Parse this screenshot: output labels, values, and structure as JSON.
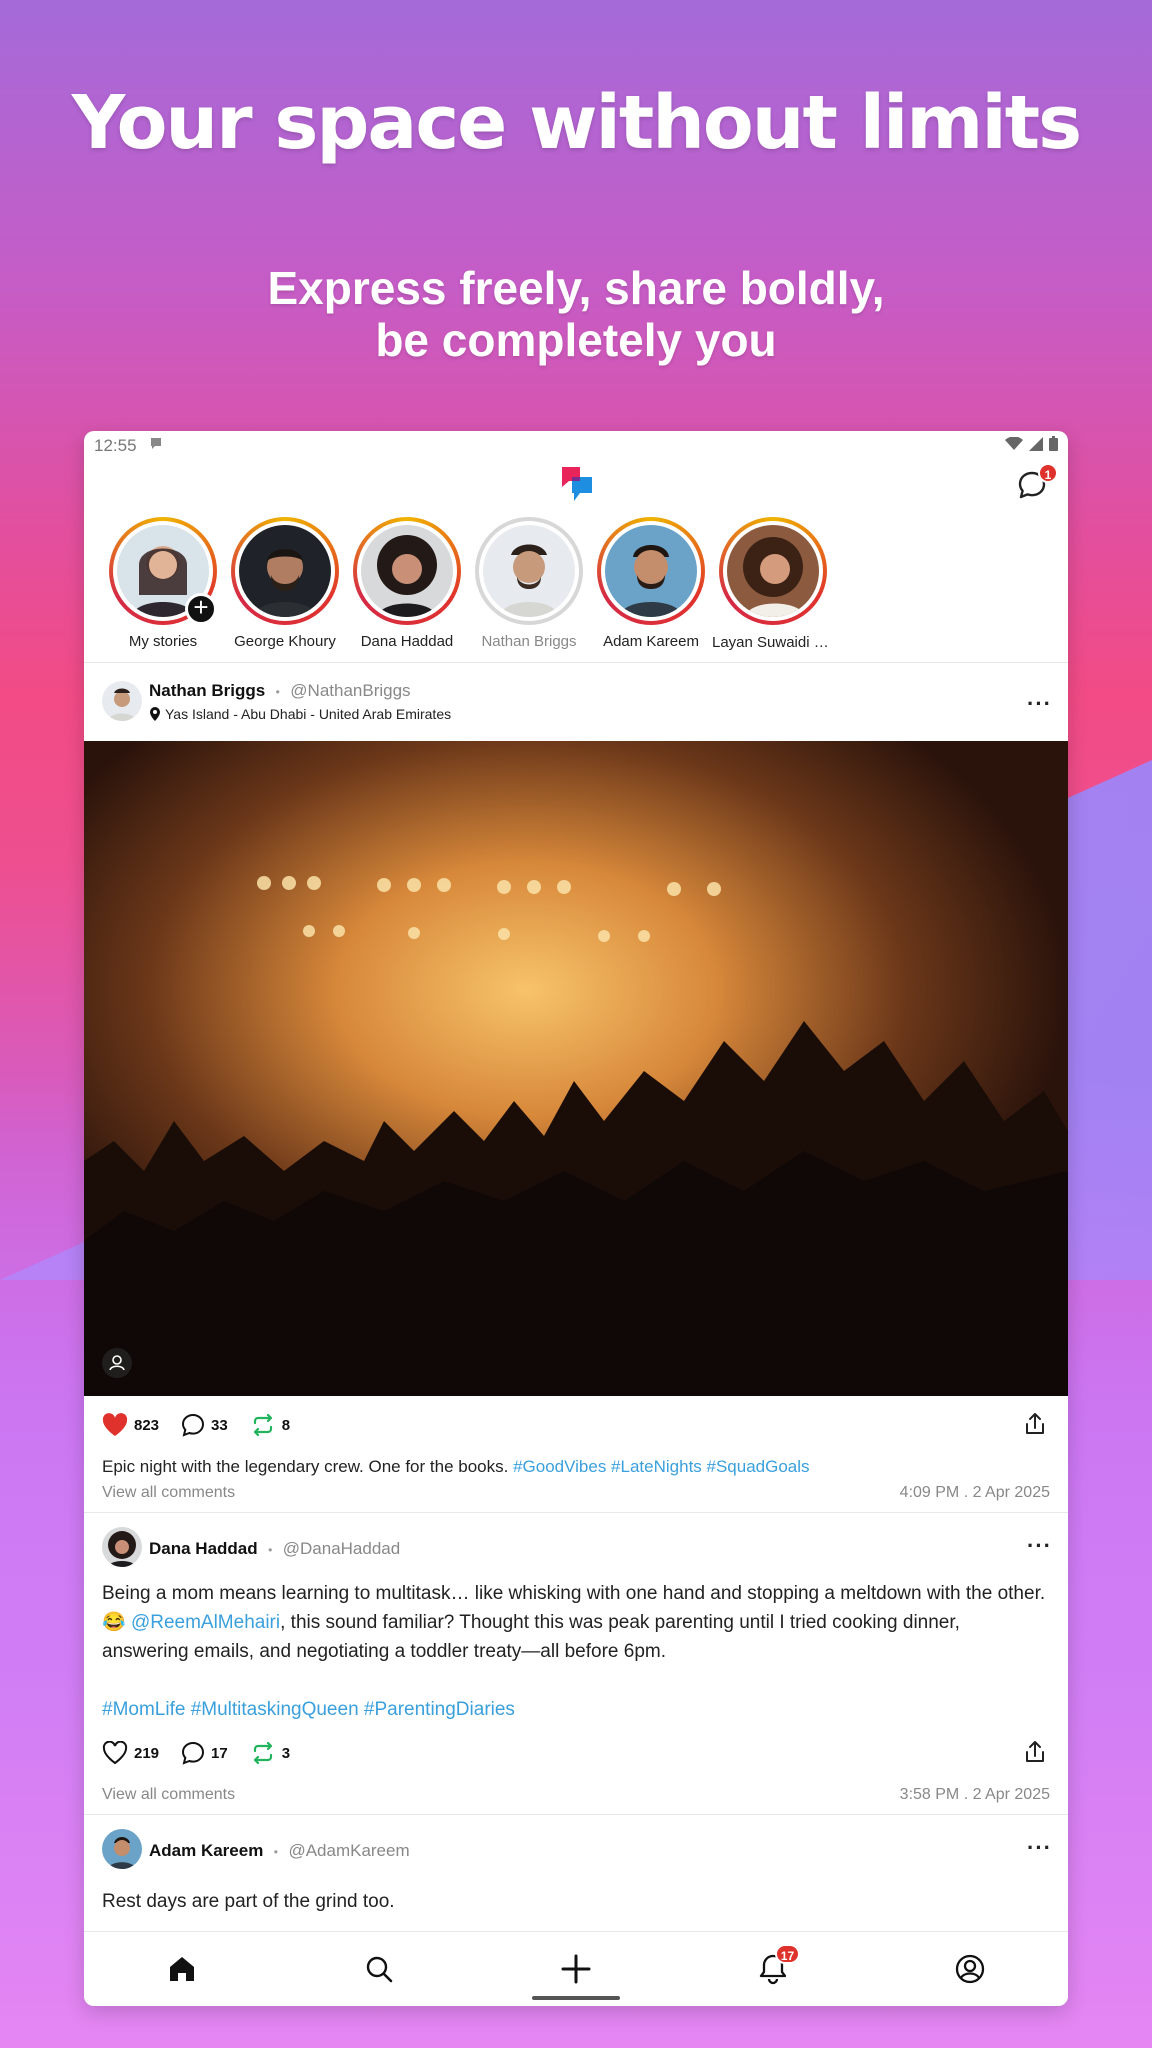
{
  "hero": {
    "title": "Your space without limits",
    "subtitle_line1": "Express freely, share boldly,",
    "subtitle_line2": "be completely you"
  },
  "statusbar": {
    "time": "12:55"
  },
  "header": {
    "messages_badge": "1"
  },
  "stories": [
    {
      "name": "My stories",
      "icon": "add-story"
    },
    {
      "name": "George Khoury"
    },
    {
      "name": "Dana Haddad"
    },
    {
      "name": "Nathan Briggs",
      "seen": true
    },
    {
      "name": "Adam Kareem"
    },
    {
      "name": "Layan Suwaidi لي..."
    }
  ],
  "posts": [
    {
      "author": "Nathan Briggs",
      "handle": "@NathanBriggs",
      "location": "Yas Island - Abu Dhabi - United Arab Emirates",
      "likes": "823",
      "comments": "33",
      "reposts": "8",
      "caption": "Epic night with the legendary crew. One for the books.",
      "tags": "#GoodVibes #LateNights #SquadGoals",
      "view_comments": "View all comments",
      "timestamp": "4:09 PM . 2 Apr 2025"
    },
    {
      "author": "Dana Haddad",
      "handle": "@DanaHaddad",
      "text_part1": "Being a mom means learning to multitask… like whisking with one hand and stopping a meltdown with the other. 😂 ",
      "mention": "@ReemAlMehairi",
      "text_part2": ", this sound familiar? Thought this was peak parenting until I tried cooking dinner, answering emails, and negotiating a toddler treaty—all before 6pm.",
      "tags": "#MomLife #MultitaskingQueen #ParentingDiaries",
      "likes": "219",
      "comments": "17",
      "reposts": "3",
      "view_comments": "View all comments",
      "timestamp": "3:58 PM . 2 Apr 2025"
    },
    {
      "author": "Adam Kareem",
      "handle": "@AdamKareem",
      "text": "Rest days are part of the grind too."
    }
  ],
  "bottom_nav": {
    "notifications_badge": "17"
  },
  "colors": {
    "accent": "#3aa0dd",
    "like": "#e0322c",
    "repost": "#22b35e"
  }
}
